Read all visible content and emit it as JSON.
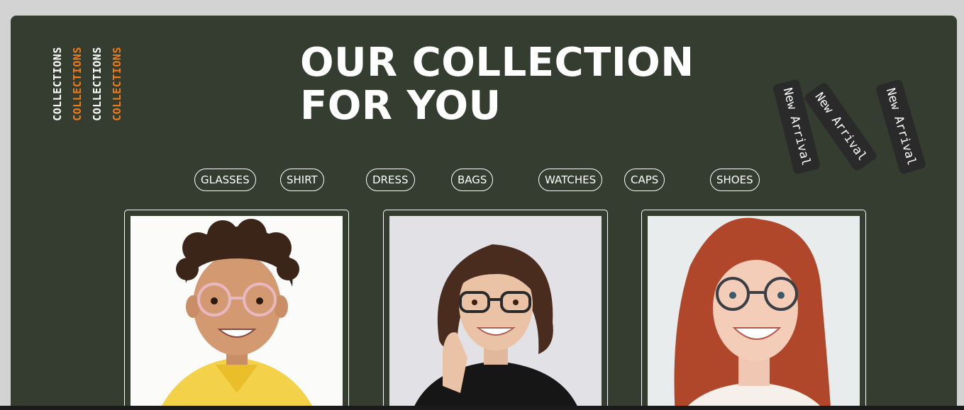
{
  "side_words": [
    "COLLECTIONS",
    "COLLECTIONS",
    "COLLECTIONS",
    "COLLECTIONS"
  ],
  "heading": {
    "line1": "OUR COLLECTION",
    "line2": "FOR YOU"
  },
  "tags": [
    "New Arrival",
    "New Arrival",
    "New Arrival"
  ],
  "categories": [
    "GLASSES",
    "SHIRT",
    "DRESS",
    "BAGS",
    "WATCHES",
    "CAPS",
    "SHOES"
  ],
  "colors": {
    "panel": "#343d2f",
    "accent": "#f07a16",
    "tag_bg": "#2a2a2a"
  }
}
